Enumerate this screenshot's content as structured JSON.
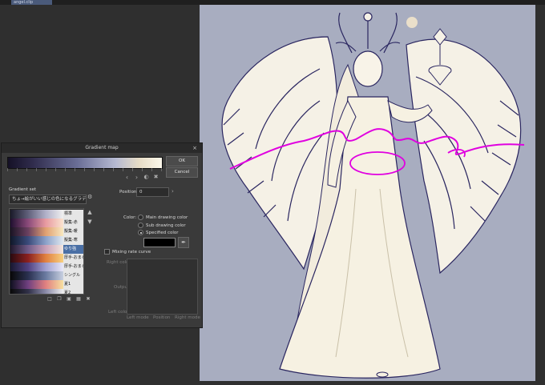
{
  "tabbar": {
    "tab_label": "angel.clip"
  },
  "dialog": {
    "title": "Gradient map",
    "close_glyph": "×",
    "ok_label": "OK",
    "cancel_label": "Cancel",
    "position_label": "Position:",
    "position_value": "0",
    "gradient_set_label": "Gradient set",
    "gradient_set_selected": "ちょ→絵がいい感じの色になるグラデーションマップ",
    "color_label": "Color:",
    "color_options": [
      "Main drawing color",
      "Sub drawing color",
      "Specified color"
    ],
    "selected_color_option": "Specified color",
    "specified_color": "#000000",
    "mixing_rate_label": "Mixing rate curve",
    "right_color_label": "Right color",
    "output_label": "Output",
    "left_color_label": "Left color",
    "axis_labels": [
      "Left mode",
      "Position",
      "Right mode"
    ],
    "gradient_items": [
      {
        "label": "標準",
        "selected": false,
        "colors": "#1a1a2a,#60607a,#b0b0c8,#f0f0f0"
      },
      {
        "label": "擬集-赤",
        "selected": false,
        "colors": "#201030,#8a4a7a,#e79aa0,#fbe4d0"
      },
      {
        "label": "擬集-暖",
        "selected": false,
        "colors": "#1a1424,#6a4060,#e0a070,#f8e8c0"
      },
      {
        "label": "擬集-寒",
        "selected": false,
        "colors": "#10182a,#3a4a7a,#8aa0c8,#e0e8f0"
      },
      {
        "label": "ゆり強",
        "selected": true,
        "colors": "#20182c,#705a88,#c8a0b8,#f4e8e0"
      },
      {
        "label": "厚手-おまる",
        "selected": false,
        "colors": "#2a0a10,#8a2020,#e08040,#f8d080"
      },
      {
        "label": "厚手-おまる弱",
        "selected": false,
        "colors": "#181830,#504080,#a0a0d0,#e8e8f8"
      },
      {
        "label": "シングル",
        "selected": false,
        "colors": "#080808,#2a3050,#6a7aa0,#c8d0e0"
      },
      {
        "label": "夏1",
        "selected": false,
        "colors": "#101020,#704080,#e08080,#f8e0a0"
      },
      {
        "label": "夏2",
        "selected": false,
        "colors": "#0a0a0a,#303048,#8a8aa8,#f0f0f0"
      }
    ]
  },
  "icons": {
    "close": "close-icon",
    "nav_left": "chevron-left-icon",
    "nav_right": "chevron-right-icon",
    "invert": "invert-icon",
    "trash": "trash-icon",
    "settings": "settings-icon",
    "eyedropper": "eyedropper-icon"
  },
  "colors": {
    "canvas_bg": "#a8adc0",
    "stroke_magenta": "#e000e0",
    "line_art": "#2a2660"
  }
}
